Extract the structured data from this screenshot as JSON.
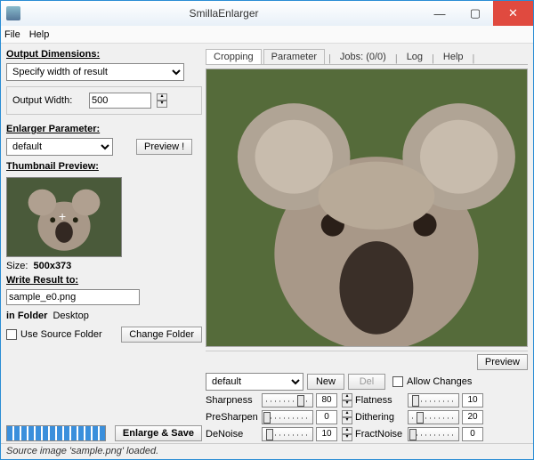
{
  "title": "SmillaEnlarger",
  "menu": {
    "file": "File",
    "help": "Help"
  },
  "left": {
    "output_dimensions": "Output Dimensions:",
    "dimension_mode": "Specify width of result",
    "output_width_label": "Output Width:",
    "output_width_value": "500",
    "enlarger_parameter": "Enlarger Parameter:",
    "param_preset": "default",
    "preview_btn": "Preview !",
    "thumbnail_preview": "Thumbnail Preview:",
    "size_label": "Size:",
    "size_value": "500x373",
    "write_result": "Write Result to:",
    "filename": "sample_e0.png",
    "in_folder": "in Folder",
    "folder_name": "Desktop",
    "use_source_folder": "Use Source Folder",
    "change_folder": "Change Folder",
    "enlarge_save": "Enlarge & Save"
  },
  "right": {
    "tabs": {
      "cropping": "Cropping",
      "parameter": "Parameter",
      "jobs": "Jobs: (0/0)",
      "log": "Log",
      "help": "Help"
    },
    "preview_btn": "Preview",
    "preset": "default",
    "new_btn": "New",
    "del_btn": "Del",
    "allow_changes": "Allow Changes",
    "params": {
      "sharpness": {
        "label": "Sharpness",
        "value": "80"
      },
      "flatness": {
        "label": "Flatness",
        "value": "10"
      },
      "presharpen": {
        "label": "PreSharpen",
        "value": "0"
      },
      "dithering": {
        "label": "Dithering",
        "value": "20"
      },
      "denoise": {
        "label": "DeNoise",
        "value": "10"
      },
      "fractnoise": {
        "label": "FractNoise",
        "value": "0"
      }
    }
  },
  "status": "Source image 'sample.png' loaded."
}
